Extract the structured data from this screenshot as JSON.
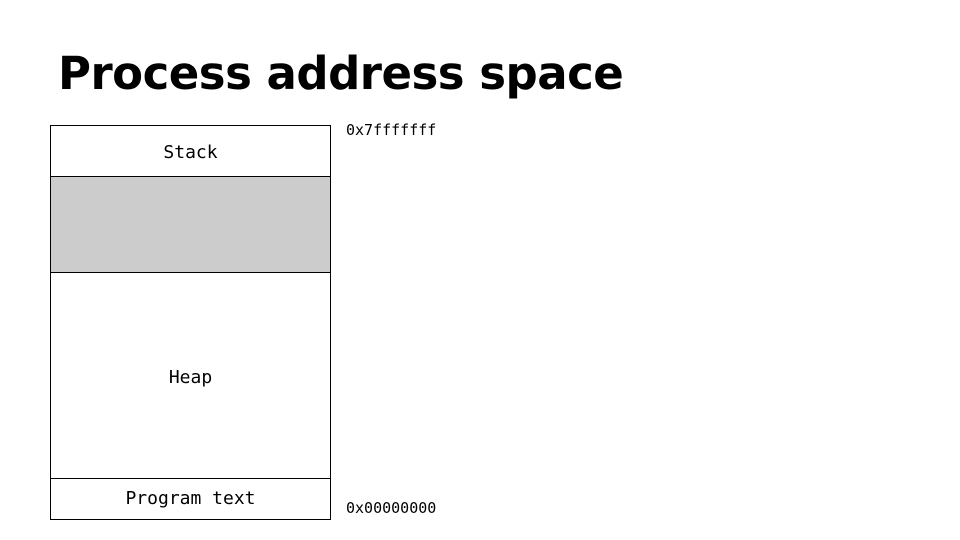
{
  "slide": {
    "title": "Process address space"
  },
  "memory": {
    "segments": [
      {
        "id": "stack",
        "label": "Stack",
        "fill": "#ffffff"
      },
      {
        "id": "free",
        "label": "",
        "fill": "#cccccc"
      },
      {
        "id": "heap",
        "label": "Heap",
        "fill": "#ffffff"
      },
      {
        "id": "program-text",
        "label": "Program text",
        "fill": "#ffffff"
      }
    ],
    "addresses": {
      "top": "0x7fffffff",
      "bottom": "0x00000000"
    }
  }
}
